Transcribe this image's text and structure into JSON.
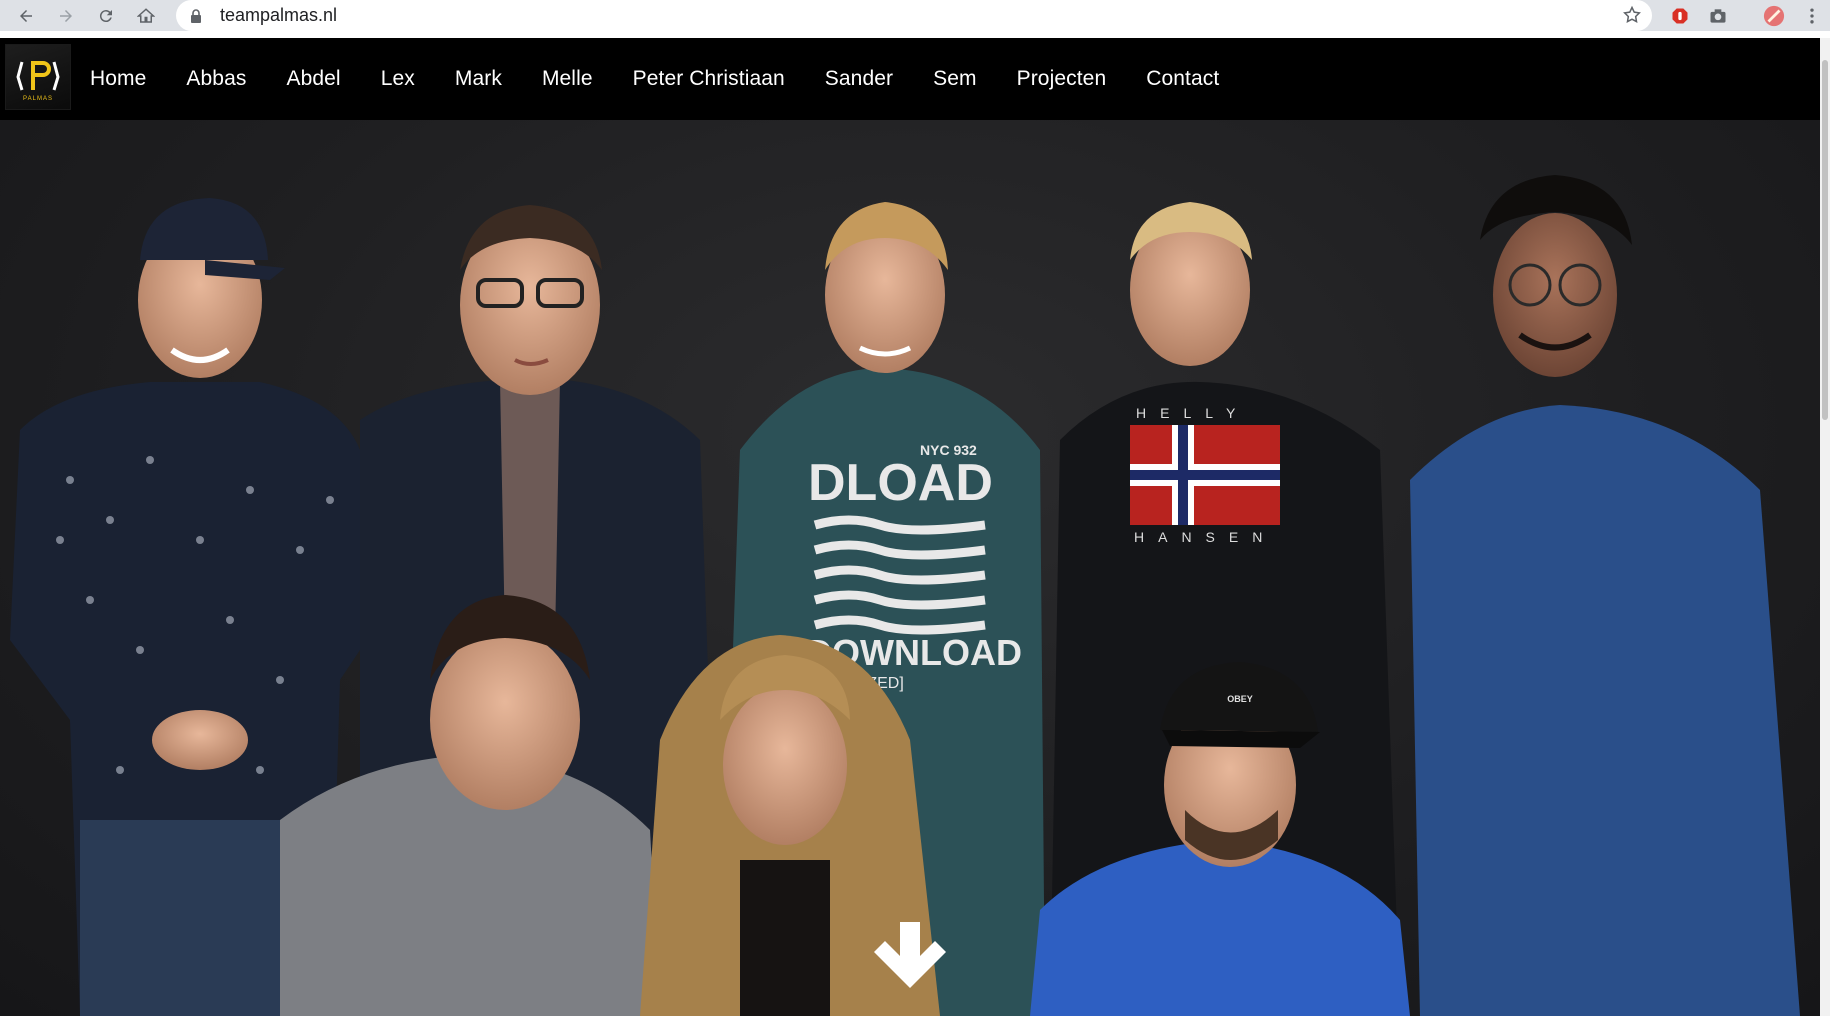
{
  "browser": {
    "url": "teampalmas.nl"
  },
  "site": {
    "logo_text": "PALMAS",
    "logo_mark": "P",
    "nav": [
      {
        "label": "Home"
      },
      {
        "label": "Abbas"
      },
      {
        "label": "Abdel"
      },
      {
        "label": "Lex"
      },
      {
        "label": "Mark"
      },
      {
        "label": "Melle"
      },
      {
        "label": "Peter Christiaan"
      },
      {
        "label": "Sander"
      },
      {
        "label": "Sem"
      },
      {
        "label": "Projecten"
      },
      {
        "label": "Contact"
      }
    ]
  },
  "hero": {
    "image_subject": "team-photo",
    "shirt_texts": [
      "NYC 932",
      "DLOAD",
      "DOWNLOAD",
      "UTHORIZED]",
      "HELLY",
      "HANSEN",
      "OBEY"
    ],
    "scroll_icon": "arrow-down-icon"
  },
  "colors": {
    "nav_bg": "#000000",
    "nav_text": "#ffffff",
    "logo_accent": "#f0c419"
  }
}
